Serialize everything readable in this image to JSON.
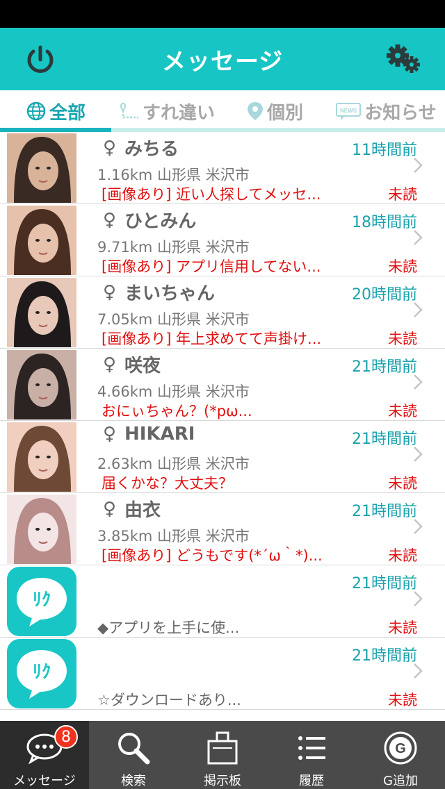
{
  "header": {
    "title": "メッセージ"
  },
  "tabs": [
    {
      "label": "全部",
      "active": true,
      "icon": "globe-icon"
    },
    {
      "label": "すれ違い",
      "active": false,
      "icon": "route-icon"
    },
    {
      "label": "個別",
      "active": false,
      "icon": "map-pin-icon"
    },
    {
      "label": "お知らせ",
      "active": false,
      "icon": "news-icon"
    }
  ],
  "messages": [
    {
      "name": "みちる",
      "time": "11時間前",
      "location": "1.16km  山形県 米沢市",
      "preview": "[画像あり] 近い人探してメッセ...",
      "status": "未読"
    },
    {
      "name": "ひとみん",
      "time": "18時間前",
      "location": "9.71km  山形県 米沢市",
      "preview": "[画像あり] アプリ信用してない...",
      "status": "未読"
    },
    {
      "name": "まいちゃん",
      "time": "20時間前",
      "location": "7.05km  山形県 米沢市",
      "preview": "[画像あり] 年上求めてて声掛け...",
      "status": "未読"
    },
    {
      "name": "咲夜",
      "time": "21時間前",
      "location": "4.66km  山形県 米沢市",
      "preview": "おにぃちゃん？(*pω...",
      "status": "未読"
    },
    {
      "name": "HIKARI",
      "time": "21時間前",
      "location": "2.63km  山形県 米沢市",
      "preview": "届くかな？大丈夫？",
      "status": "未読"
    },
    {
      "name": "由衣",
      "time": "21時間前",
      "location": "3.85km  山形県 米沢市",
      "preview": "[画像あり] どうもです(*´ω｀*)...",
      "status": "未読"
    },
    {
      "name": "",
      "time": "21時間前",
      "location": "",
      "preview": "◆アプリを上手に使...",
      "status": "未読"
    },
    {
      "name": "",
      "time": "21時間前",
      "location": "",
      "preview": "☆ダウンロードあり...",
      "status": "未読"
    }
  ],
  "logo_text": "ﾘｸ",
  "tabbar": [
    {
      "label": "メッセージ",
      "active": true,
      "badge": "8"
    },
    {
      "label": "検索",
      "active": false
    },
    {
      "label": "掲示板",
      "active": false
    },
    {
      "label": "履歴",
      "active": false
    },
    {
      "label": "G追加",
      "active": false
    }
  ],
  "gender_symbol": "♀",
  "colors": {
    "accent": "#17c5c5",
    "unread": "#e01010",
    "time": "#1aa2ad"
  }
}
